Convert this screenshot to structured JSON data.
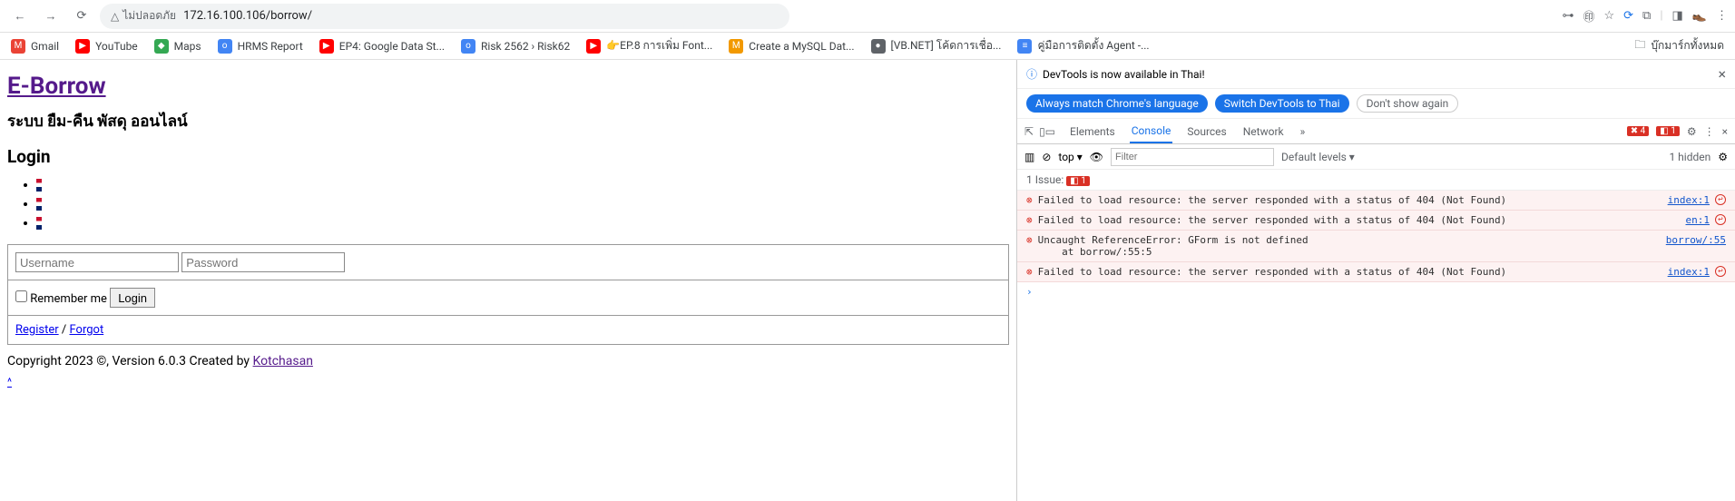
{
  "toolbar": {
    "secure_text": "ไม่ปลอดภัย",
    "url": "172.16.100.106/borrow/"
  },
  "bookmarks": {
    "items": [
      {
        "label": "Gmail"
      },
      {
        "label": "YouTube"
      },
      {
        "label": "Maps"
      },
      {
        "label": "HRMS Report"
      },
      {
        "label": "EP4: Google Data St..."
      },
      {
        "label": "Risk 2562 › Risk62"
      },
      {
        "label": "👉EP.8 การเพิ่ม Font..."
      },
      {
        "label": "Create a MySQL Dat..."
      },
      {
        "label": "[VB.NET] โค้ดการเชื่อ..."
      },
      {
        "label": "คู่มือการติดตั้ง Agent -..."
      }
    ],
    "right": "บุ๊กมาร์กทั้งหมด"
  },
  "page": {
    "brand": "E-Borrow",
    "tagline": "ระบบ ยืม-คืน พัสดุ ออนไลน์",
    "login_heading": "Login",
    "username_ph": "Username",
    "password_ph": "Password",
    "remember": "Remember me",
    "login_btn": "Login",
    "register": "Register",
    "sep": "/",
    "forgot": "Forgot",
    "copyright": "Copyright 2023 ©, Version 6.0.3 Created by ",
    "author": "Kotchasan",
    "caret": "^"
  },
  "devtools": {
    "info": "DevTools is now available in Thai!",
    "pill1": "Always match Chrome's language",
    "pill2": "Switch DevTools to Thai",
    "pill3": "Don't show again",
    "tabs": {
      "elements": "Elements",
      "console": "Console",
      "sources": "Sources",
      "network": "Network"
    },
    "err_count": "4",
    "warn_count": "1",
    "filter": {
      "top": "top ▾",
      "filter_ph": "Filter",
      "levels": "Default levels ▾",
      "hidden": "1 hidden"
    },
    "issue": "1 Issue:",
    "issue_badge": "1",
    "messages": [
      {
        "text": "Failed to load resource: the server responded with a status of 404 (Not Found)",
        "src": "index:1"
      },
      {
        "text": "Failed to load resource: the server responded with a status of 404 (Not Found)",
        "src": "en:1"
      },
      {
        "text": "Uncaught ReferenceError: GForm is not defined\n    at borrow/:55:5",
        "src": "borrow/:55"
      },
      {
        "text": "Failed to load resource: the server responded with a status of 404 (Not Found)",
        "src": "index:1"
      }
    ]
  }
}
